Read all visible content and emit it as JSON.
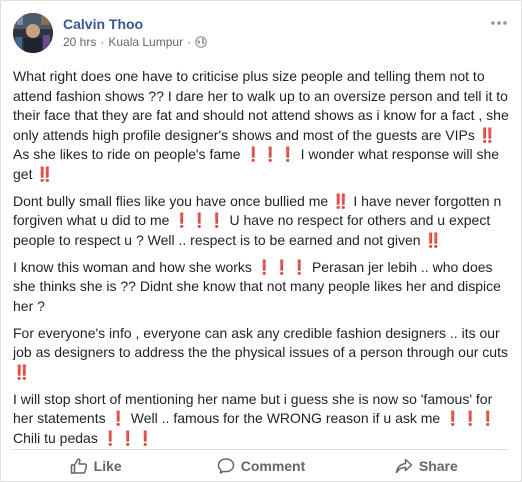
{
  "post": {
    "author": "Calvin Thoo",
    "time": "20 hrs",
    "separator": "·",
    "location": "Kuala Lumpur",
    "audience_icon": "globe-icon",
    "paragraphs": [
      "What right does one have to criticise plus size people and telling them not to attend fashion shows ?? I dare her to walk up to an oversize person and tell it to their face that they are fat and should not attend shows as i know for a fact , she only attends high profile designer's shows and most of the guests are VIPs ‼️ As she likes to ride on people's fame ❗❗❗ I wonder what response will she get ‼️",
      "Dont bully small flies like you have once bullied me ‼️ I have never forgotten n forgiven what u did to me ❗❗❗ U have no respect for others and u expect people to respect u ? Well .. respect is to be earned and not given ‼️",
      "I know this woman and how she works ❗❗❗ Perasan jer lebih .. who does she thinks she is ?? Didnt she know that not many people likes her and dispice her ?",
      "For everyone's info , everyone can ask any credible fashion designers .. its our job as designers to address the the physical issues of a person through our cuts ‼️",
      "I will stop short of mentioning her name but i guess she is now so 'famous' for her statements ❗ Well .. famous for the WRONG reason if u ask me ❗❗❗ Chili tu pedas ❗❗❗"
    ]
  },
  "actions": {
    "like": "Like",
    "comment": "Comment",
    "share": "Share"
  },
  "colors": {
    "author": "#365899",
    "text": "#1d2129",
    "meta": "#616770",
    "action": "#606770"
  }
}
